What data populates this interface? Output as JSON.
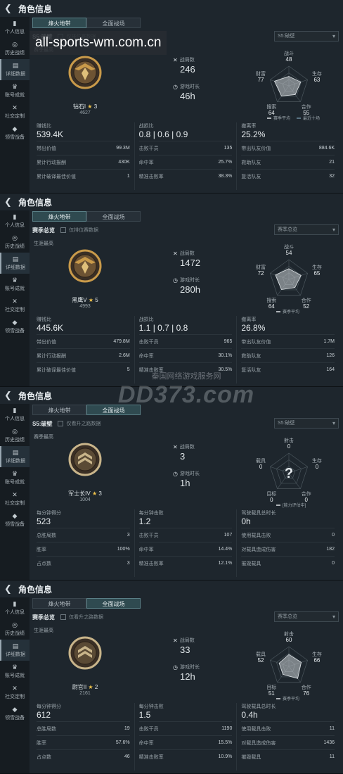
{
  "watermark_top": "all-sports-wm.com.cn",
  "watermark_mid": {
    "small": "秦国网络游戏服务网",
    "big": "DD373.com"
  },
  "sidebar": [
    "个人信息",
    "历史战绩",
    "详细数据",
    "账号成就",
    "社交定制",
    "领雪战备"
  ],
  "panels": [
    {
      "title": "角色信息",
      "tabs": [
        "烽火地带",
        "全面战场"
      ],
      "active_tab": 0,
      "season": "S5:破壁",
      "checkbox_label": "仅排位赛数据",
      "select": "S5:破壁",
      "career_label": "赛季最高",
      "badge_type": "gold",
      "rank_name": "钻石I",
      "rank_stars": "3",
      "rank_points": "4627",
      "kpi1_label": "战局数",
      "kpi1_value": "246",
      "kpi2_label": "游戏时长",
      "kpi2_value": "46h",
      "radar": {
        "labels": [
          "战斗",
          "生存",
          "合作",
          "搜索",
          "财富"
        ],
        "values": [
          48,
          63,
          55,
          64,
          77
        ],
        "legend": [
          "赛季平均",
          "最近十场"
        ],
        "mystery": false
      },
      "stat_cols": [
        {
          "label": "赚钱比",
          "value": "539.4K",
          "rows": [
            [
              "带出价值",
              "99.3M"
            ],
            [
              "累计行动报酬",
              "430K"
            ],
            [
              "累计破译最佳价值",
              "1"
            ]
          ]
        },
        {
          "label": "战损比",
          "value": "0.8  |  0.6  |  0.9",
          "rows": [
            [
              "击败干员",
              "135"
            ],
            [
              "命中率",
              "25.7%"
            ],
            [
              "精准击败率",
              "38.3%"
            ]
          ]
        },
        {
          "label": "撤离率",
          "value": "25.2%",
          "rows": [
            [
              "带出队友价值",
              "884.6K"
            ],
            [
              "救助队友",
              "21"
            ],
            [
              "复活队友",
              "32"
            ]
          ]
        }
      ]
    },
    {
      "title": "角色信息",
      "tabs": [
        "烽火地带",
        "全面战场"
      ],
      "active_tab": 0,
      "season": "赛季总览",
      "checkbox_label": "仅排位赛数据",
      "select": "赛季总览",
      "career_label": "生涯最高",
      "badge_type": "gold2",
      "rank_name": "黑鹰V",
      "rank_stars": "5",
      "rank_points": "4993",
      "kpi1_label": "战局数",
      "kpi1_value": "1472",
      "kpi2_label": "游戏时长",
      "kpi2_value": "280h",
      "radar": {
        "labels": [
          "战斗",
          "生存",
          "合作",
          "搜索",
          "财富"
        ],
        "values": [
          54,
          65,
          52,
          64,
          72
        ],
        "legend": [
          "赛季平均"
        ],
        "mystery": false
      },
      "stat_cols": [
        {
          "label": "赚钱比",
          "value": "445.6K",
          "rows": [
            [
              "带出价值",
              "479.8M"
            ],
            [
              "累计行动报酬",
              "2.6M"
            ],
            [
              "累计破译最佳价值",
              "5"
            ]
          ]
        },
        {
          "label": "战损比",
          "value": "1.1  |  0.7  |  0.8",
          "rows": [
            [
              "击败干员",
              "965"
            ],
            [
              "命中率",
              "30.1%"
            ],
            [
              "精准击败率",
              "30.5%"
            ]
          ]
        },
        {
          "label": "撤离率",
          "value": "26.8%",
          "rows": [
            [
              "带出队友价值",
              "1.7M"
            ],
            [
              "救助队友",
              "126"
            ],
            [
              "复活队友",
              "164"
            ]
          ]
        }
      ]
    },
    {
      "title": "角色信息",
      "tabs": [
        "烽火地带",
        "全面战场"
      ],
      "active_tab": 1,
      "season": "S5:破壁",
      "checkbox_label": "仅看升之路数据",
      "select": "S5:破壁",
      "career_label": "赛季最高",
      "badge_type": "silver",
      "rank_name": "军士长IV",
      "rank_stars": "3",
      "rank_points": "1004",
      "kpi1_label": "战局数",
      "kpi1_value": "3",
      "kpi2_label": "游戏时长",
      "kpi2_value": "1h",
      "radar": {
        "labels": [
          "射击",
          "生存",
          "合作",
          "目标",
          "载具"
        ],
        "values": [
          0,
          0,
          0,
          0,
          0
        ],
        "legend": [
          "[能力评估中]"
        ],
        "mystery": true
      },
      "stat_cols": [
        {
          "label": "每分钟得分",
          "value": "523",
          "rows": [
            [
              "总胜局数",
              "3"
            ],
            [
              "胜率",
              "100%"
            ],
            [
              "占点数",
              "3"
            ]
          ]
        },
        {
          "label": "每分钟击败",
          "value": "1.2",
          "rows": [
            [
              "击败干员",
              "107"
            ],
            [
              "命中率",
              "14.4%"
            ],
            [
              "精准击败率",
              "12.1%"
            ]
          ]
        },
        {
          "label": "驾驶载具总时长",
          "value": "0h",
          "rows": [
            [
              "使用载具击败",
              "0"
            ],
            [
              "对载具造成伤害",
              "182"
            ],
            [
              "摧毁载具",
              "0"
            ]
          ]
        }
      ]
    },
    {
      "title": "角色信息",
      "tabs": [
        "烽火地带",
        "全面战场"
      ],
      "active_tab": 1,
      "season": "赛季总览",
      "checkbox_label": "仅看升之路数据",
      "select": "赛季总览",
      "career_label": "生涯最高",
      "badge_type": "silver",
      "rank_name": "尉官II",
      "rank_stars": "2",
      "rank_points": "2161",
      "kpi1_label": "战局数",
      "kpi1_value": "33",
      "kpi2_label": "游戏时长",
      "kpi2_value": "12h",
      "radar": {
        "labels": [
          "射击",
          "生存",
          "合作",
          "目标",
          "载具"
        ],
        "values": [
          60,
          66,
          76,
          51,
          52
        ],
        "legend": [
          "赛季平均"
        ],
        "mystery": false
      },
      "stat_cols": [
        {
          "label": "每分钟得分",
          "value": "612",
          "rows": [
            [
              "总胜局数",
              "19"
            ],
            [
              "胜率",
              "57.6%"
            ],
            [
              "占点数",
              "46"
            ]
          ]
        },
        {
          "label": "每分钟击败",
          "value": "1.5",
          "rows": [
            [
              "击败干员",
              "1190"
            ],
            [
              "命中率",
              "15.5%"
            ],
            [
              "精准击败率",
              "10.9%"
            ]
          ]
        },
        {
          "label": "驾驶载具总时长",
          "value": "0.4h",
          "rows": [
            [
              "使用载具击败",
              "11"
            ],
            [
              "对载具造成伤害",
              "1436"
            ],
            [
              "摧毁载具",
              "11"
            ]
          ]
        }
      ]
    }
  ],
  "colors": {
    "accent": "#5a7f86",
    "gold": "#c99a4a",
    "silver": "#c8b48a",
    "star": "#f0c24a"
  }
}
